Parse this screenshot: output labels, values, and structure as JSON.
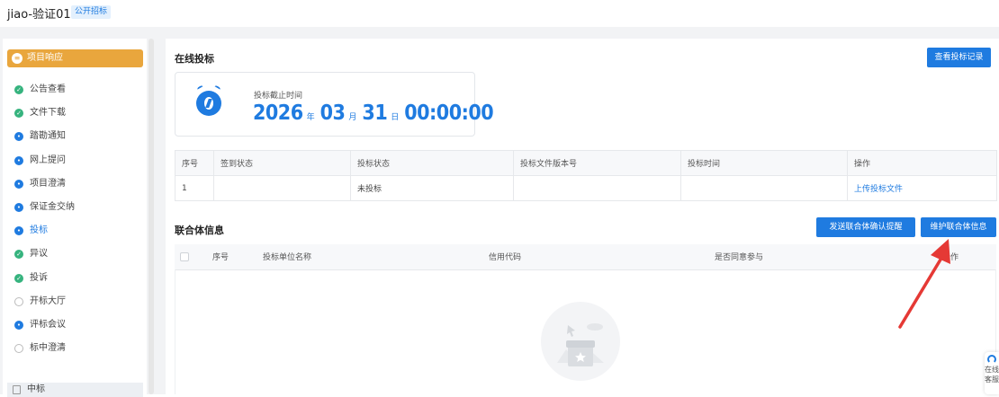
{
  "header": {
    "title": "jiao-验证01",
    "badge": "公开招标"
  },
  "sidebar": {
    "head": "项目响应",
    "items": [
      {
        "label": "公告查看",
        "status": "done"
      },
      {
        "label": "文件下载",
        "status": "done"
      },
      {
        "label": "踏勘通知",
        "status": "progress"
      },
      {
        "label": "网上提问",
        "status": "progress"
      },
      {
        "label": "项目澄清",
        "status": "progress"
      },
      {
        "label": "保证金交纳",
        "status": "progress"
      },
      {
        "label": "投标",
        "status": "progress",
        "active": true
      },
      {
        "label": "异议",
        "status": "done"
      },
      {
        "label": "投诉",
        "status": "done"
      },
      {
        "label": "开标大厅",
        "status": "pending"
      },
      {
        "label": "评标会议",
        "status": "progress"
      },
      {
        "label": "标中澄清",
        "status": "pending"
      }
    ],
    "footer": "中标"
  },
  "online_bid": {
    "title": "在线投标",
    "view_records_button": "查看投标记录",
    "deadline_label": "投标截止时间",
    "deadline": {
      "year": "2026",
      "year_unit": "年",
      "month": "03",
      "month_unit": "月",
      "day": "31",
      "day_unit": "日",
      "time": "00:00:00"
    },
    "table": {
      "headers": [
        "序号",
        "签到状态",
        "投标状态",
        "投标文件版本号",
        "投标时间",
        "操作"
      ],
      "rows": [
        {
          "index": "1",
          "sign_status": "",
          "bid_status": "未投标",
          "version": "",
          "time": "",
          "action": "上传投标文件"
        }
      ]
    }
  },
  "consortium": {
    "title": "联合体信息",
    "send_reminder_button": "发送联合体确认提醒",
    "maintain_button": "维护联合体信息",
    "headers": [
      "序号",
      "投标单位名称",
      "信用代码",
      "是否同意参与",
      "操作"
    ]
  },
  "help": {
    "label": "在线客服"
  },
  "colors": {
    "accent": "#1f7be0",
    "sidebar_head": "#e9a63d",
    "done": "#36b37e",
    "annotation_arrow": "#e53935"
  }
}
